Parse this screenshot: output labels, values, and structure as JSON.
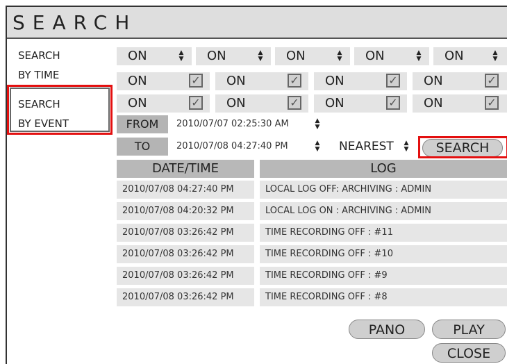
{
  "window": {
    "title": "SEARCH"
  },
  "sidebar": {
    "time_line1": "SEARCH",
    "time_line2": "BY TIME",
    "event_line1": "SEARCH",
    "event_line2": "BY EVENT"
  },
  "time_toggles": [
    "ON",
    "ON",
    "ON",
    "ON",
    "ON"
  ],
  "event_row1": [
    {
      "label": "ON",
      "checked": true
    },
    {
      "label": "ON",
      "checked": true
    },
    {
      "label": "ON",
      "checked": true
    },
    {
      "label": "ON",
      "checked": true
    }
  ],
  "event_row2": [
    {
      "label": "ON",
      "checked": true
    },
    {
      "label": "ON",
      "checked": true
    },
    {
      "label": "ON",
      "checked": true
    },
    {
      "label": "ON",
      "checked": true
    }
  ],
  "range": {
    "from_label": "FROM",
    "from_value": "2010/07/07 02:25:30 AM",
    "to_label": "TO",
    "to_value": "2010/07/08 04:27:40 PM",
    "mode": "NEAREST",
    "search_button": "SEARCH"
  },
  "table": {
    "headers": [
      "DATE/TIME",
      "LOG"
    ],
    "rows": [
      [
        "2010/07/08 04:27:40 PM",
        "LOCAL LOG OFF: ARCHIVING : ADMIN"
      ],
      [
        "2010/07/08 04:20:32 PM",
        "LOCAL LOG ON : ARCHIVING : ADMIN"
      ],
      [
        "2010/07/08 03:26:42 PM",
        "TIME RECORDING OFF : #11"
      ],
      [
        "2010/07/08 03:26:42 PM",
        "TIME RECORDING OFF : #10"
      ],
      [
        "2010/07/08 03:26:42 PM",
        "TIME RECORDING OFF : #9"
      ],
      [
        "2010/07/08 03:26:42 PM",
        "TIME RECORDING OFF : #8"
      ]
    ]
  },
  "buttons": {
    "pano": "PANO",
    "play": "PLAY",
    "close": "CLOSE"
  },
  "colors": {
    "highlight": "#e31010",
    "header_bg": "#b8b8b8",
    "cell_bg": "#e6e6e6"
  }
}
